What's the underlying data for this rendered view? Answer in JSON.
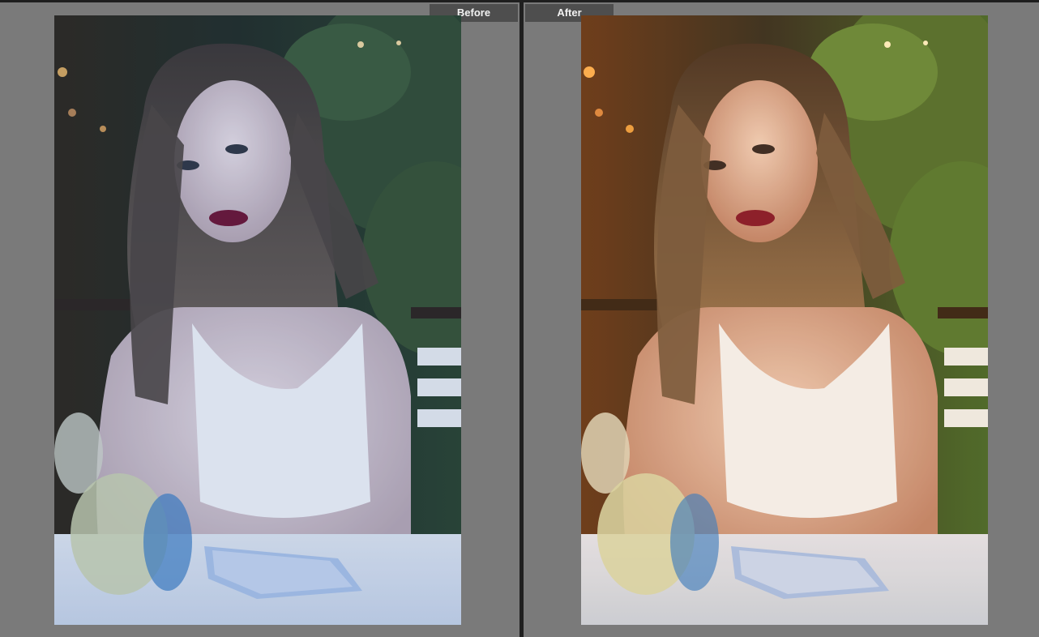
{
  "compare": {
    "before_label": "Before",
    "after_label": "After"
  },
  "colors": {
    "pane_background": "#7a7a7a",
    "label_background": "#4e4e4e",
    "divider": "#1f1f1f"
  }
}
